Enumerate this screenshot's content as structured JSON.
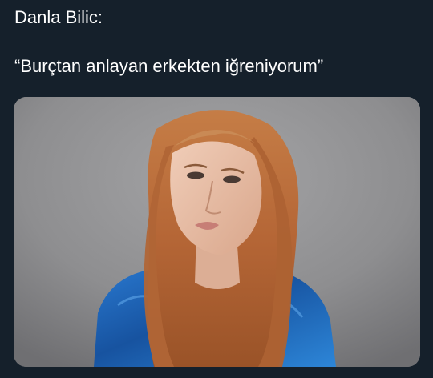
{
  "post": {
    "author_line": "Danla Bilic:",
    "quote_line": "“Burçtan anlayan erkekten iğreniyorum”"
  },
  "media": {
    "description_icon": "portrait-photo-icon"
  },
  "colors": {
    "background": "#15202b",
    "text": "#ffffff",
    "photo_backdrop": "#8d8d8f",
    "hair": "#b86a3a",
    "shirt": "#1f67b5"
  }
}
